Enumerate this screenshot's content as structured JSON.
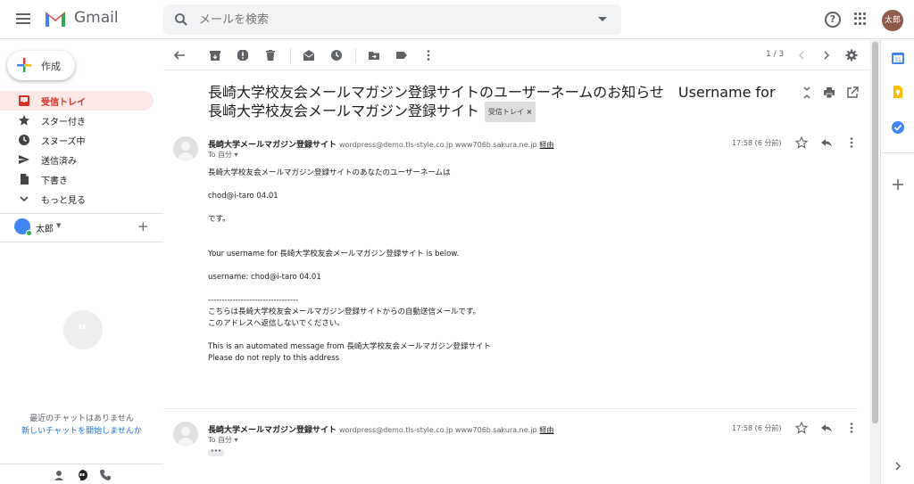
{
  "header": {
    "app_name": "Gmail",
    "search_placeholder": "メールを検索",
    "avatar_text": "太郎",
    "help_text": "?"
  },
  "compose": {
    "label": "作成"
  },
  "sidebar": {
    "items": [
      {
        "label": "受信トレイ",
        "icon": "inbox-icon",
        "active": true
      },
      {
        "label": "スター付き",
        "icon": "star-icon",
        "active": false
      },
      {
        "label": "スヌーズ中",
        "icon": "clock-icon",
        "active": false
      },
      {
        "label": "送信済み",
        "icon": "send-icon",
        "active": false
      },
      {
        "label": "下書き",
        "icon": "draft-icon",
        "active": false
      },
      {
        "label": "もっと見る",
        "icon": "chevron-down-icon",
        "active": false
      }
    ],
    "user_name": "太郎",
    "chat_empty": "最近のチャットはありません",
    "chat_start": "新しいチャットを開始しませんか"
  },
  "toolbar": {
    "pager": "1 / 3"
  },
  "thread": {
    "subject": "長崎大学校友会メールマガジン登録サイトのユーザーネームのお知らせ　Username for 長崎大学校友会メールマガジン登録サイト",
    "label": "受信トレイ",
    "label_close": "×",
    "messages": [
      {
        "sender": "長崎大学メールマガジン登録サイト",
        "address": "wordpress@demo.tls-style.co.jp www706b.sakura.ne.jp",
        "via": "経由",
        "to": "To 自分",
        "time": "17:58 (6 分前)",
        "body": [
          "長崎大学校友会メールマガジン登録サイトのあなたのユーザーネームは",
          "",
          "chod@i-taro 04.01",
          "",
          "です。",
          "",
          "",
          "Your username for 長崎大学校友会メールマガジン登録サイト is below.",
          "",
          "username: chod@i-taro 04.01",
          "",
          "---------------------------------",
          "こちらは長崎大学校友会メールマガジン登録サイトからの自動送信メールです。",
          "このアドレスへ返信しないでください。",
          "",
          "This is an automated message from 長崎大学校友会メールマガジン登録サイト",
          "Please do not reply to this address"
        ]
      },
      {
        "sender": "長崎大学メールマガジン登録サイト",
        "address": "wordpress@demo.tls-style.co.jp www706b.sakura.ne.jp",
        "via": "経由",
        "to": "To 自分",
        "time": "17:58 (6 分前)",
        "snippet": "•••"
      }
    ]
  },
  "colors": {
    "accent": "#d93025",
    "link": "#1a73e8",
    "active_bg": "#fce8e6"
  }
}
